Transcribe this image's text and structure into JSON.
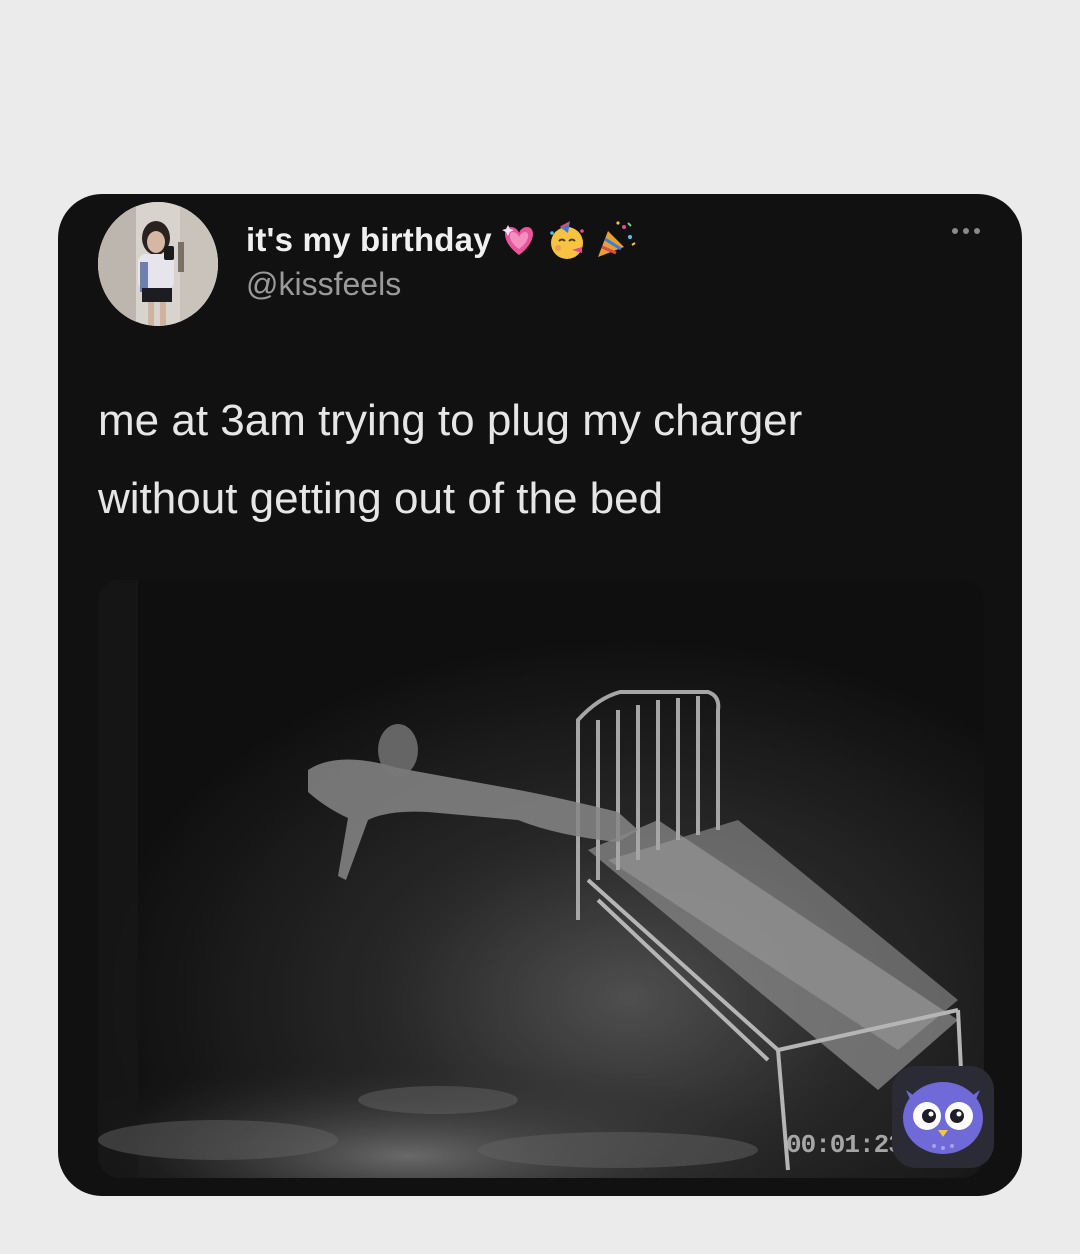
{
  "author": {
    "display_name": "it's my birthday",
    "handle": "@kissfeels",
    "name_emojis": [
      "heart-emoji-icon",
      "party-face-emoji-icon",
      "party-popper-emoji-icon"
    ]
  },
  "tweet": {
    "text_line1": "me at 3am trying to plug my charger",
    "text_line2": "without getting out of the bed"
  },
  "media": {
    "timestamp": "00:01:23"
  },
  "icons": {
    "more": "more-options-icon",
    "badge": "owl-app-icon"
  },
  "colors": {
    "page_background": "#ebebeb",
    "card_background": "#111111",
    "text_primary": "#e6e6e6",
    "text_secondary": "#9a9a9a",
    "badge_owl": "#6f6ad8"
  }
}
